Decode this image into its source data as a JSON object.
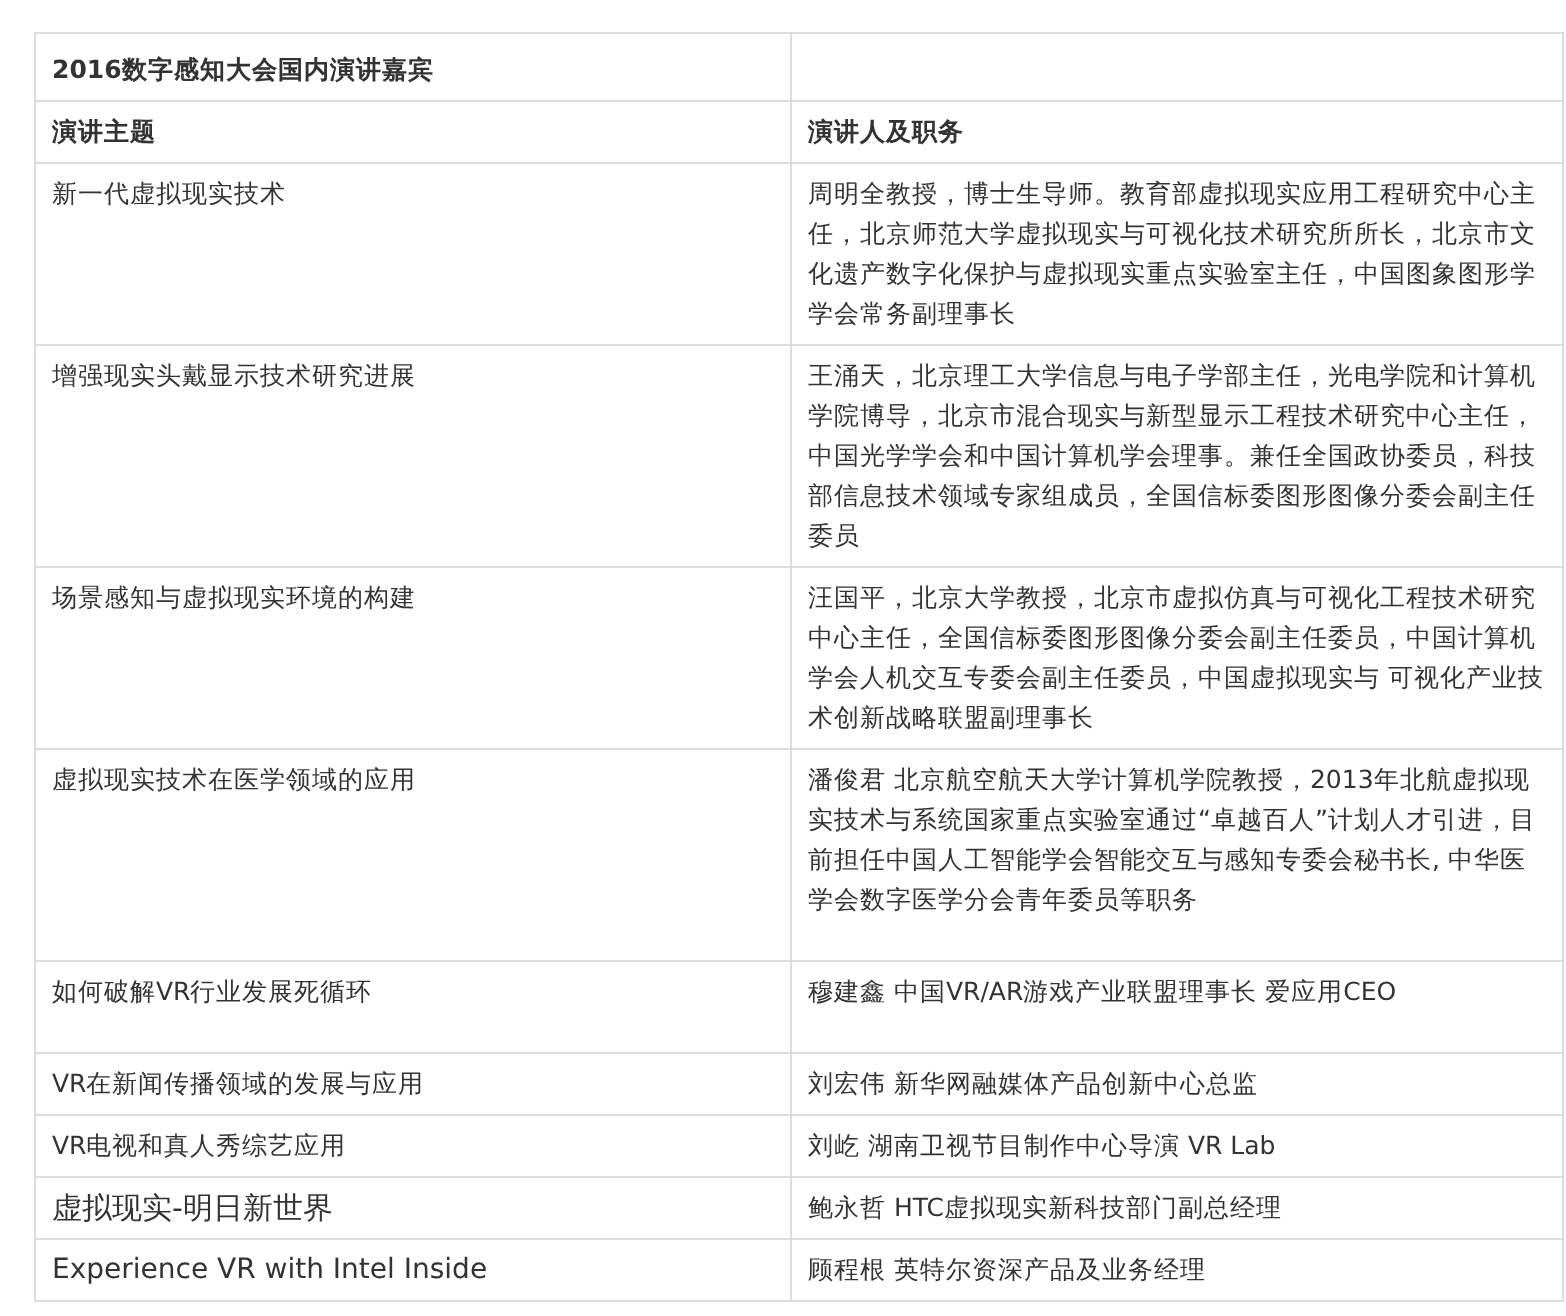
{
  "table": {
    "title": "2016数字感知大会国内演讲嘉宾",
    "columns": [
      "演讲主题",
      "演讲人及职务"
    ],
    "rows": [
      {
        "topic": "新一代虚拟现实技术",
        "speaker": "周明全教授，博士生导师。教育部虚拟现实应用工程研究中心主任，北京师范大学虚拟现实与可视化技术研究所所长，北京市文化遗产数字化保护与虚拟现实重点实验室主任，中国图象图形学学会常务副理事长"
      },
      {
        "topic": "增强现实头戴显示技术研究进展",
        "speaker": "王涌天，北京理工大学信息与电子学部主任，光电学院和计算机学院博导，北京市混合现实与新型显示工程技术研究中心主任，中国光学学会和中国计算机学会理事。兼任全国政协委员，科技部信息技术领域专家组成员，全国信标委图形图像分委会副主任委员"
      },
      {
        "topic": "场景感知与虚拟现实环境的构建",
        "speaker": "汪国平，北京大学教授，北京市虚拟仿真与可视化工程技术研究中心主任，全国信标委图形图像分委会副主任委员，中国计算机学会人机交互专委会副主任委员，中国虚拟现实与 可视化产业技术创新战略联盟副理事长"
      },
      {
        "topic": "虚拟现实技术在医学领域的应用",
        "speaker": "潘俊君 北京航空航天大学计算机学院教授，2013年北航虚拟现实技术与系统国家重点实验室通过“卓越百人”计划人才引进，目前担任中国人工智能学会智能交互与感知专委会秘书长, 中华医学会数字医学分会青年委员等职务"
      },
      {
        "topic": "如何破解VR行业发展死循环",
        "speaker": "穆建鑫 中国VR/AR游戏产业联盟理事长 爱应用CEO"
      },
      {
        "topic": "VR在新闻传播领域的发展与应用",
        "speaker": "刘宏伟 新华网融媒体产品创新中心总监"
      },
      {
        "topic": "VR电视和真人秀综艺应用",
        "speaker": "刘屹 湖南卫视节目制作中心导演 VR Lab"
      },
      {
        "topic": "虚拟现实-明日新世界",
        "speaker": "鲍永哲 HTC虚拟现实新科技部门副总经理"
      },
      {
        "topic": "Experience VR with Intel Inside",
        "speaker": "顾程根 英特尔资深产品及业务经理"
      }
    ]
  }
}
